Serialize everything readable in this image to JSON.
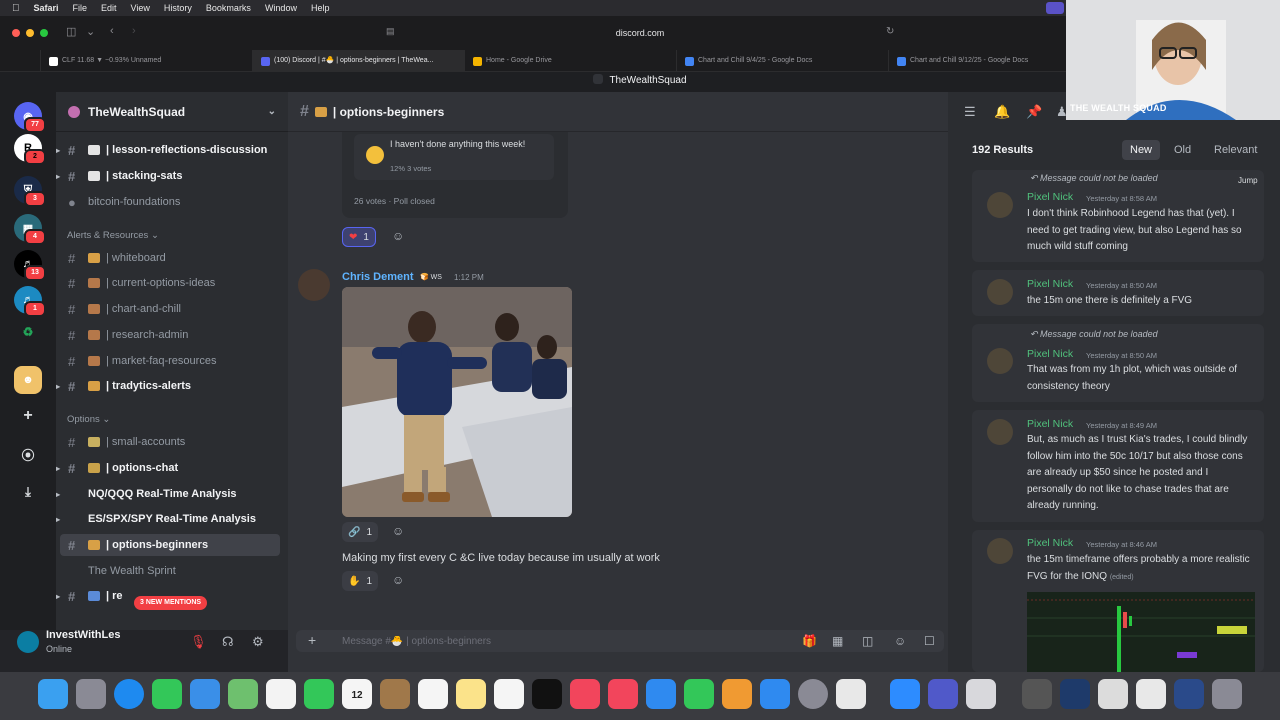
{
  "menubar": {
    "app": "Safari",
    "items": [
      "File",
      "Edit",
      "View",
      "History",
      "Bookmarks",
      "Window",
      "Help"
    ]
  },
  "browser": {
    "url": "discord.com",
    "tabs": [
      {
        "label": "CLF 11.68 ▼ −0.93% Unnamed",
        "active": false
      },
      {
        "label": "(100) Discord | #🐣 | options-beginners | TheWea...",
        "active": true
      },
      {
        "label": "Home - Google Drive",
        "active": false
      },
      {
        "label": "Chart and Chill 9/4/25 - Google Docs",
        "active": false
      },
      {
        "label": "Chart and Chill 9/12/25 - Google Docs",
        "active": false
      }
    ],
    "window_title": "TheWealthSquad"
  },
  "rail": {
    "servers": [
      {
        "icon": "discord-home-icon",
        "badge": "77"
      },
      {
        "icon": "server-r-icon",
        "letter": "R",
        "badge": "2"
      },
      {
        "icon": "server-shield-icon",
        "badge": "3"
      },
      {
        "icon": "server-book-icon",
        "badge": "4"
      },
      {
        "icon": "server-speaker-icon",
        "badge": "13"
      },
      {
        "icon": "server-speaker-icon",
        "badge": "1"
      },
      {
        "icon": "server-leaf-icon",
        "badge": ""
      },
      {
        "icon": "server-wealthsquad-icon",
        "badge": ""
      }
    ]
  },
  "server": {
    "name": "TheWealthSquad"
  },
  "sidebar": {
    "channels": [
      {
        "name": "| lesson-reflections-discussion",
        "unread": true,
        "arrow": true
      },
      {
        "name": "| stacking-sats",
        "unread": true,
        "arrow": true
      },
      {
        "name": "bitcoin-foundations",
        "unread": false,
        "arrow": false,
        "muted": true
      },
      {
        "name": "| whiteboard",
        "unread": false
      },
      {
        "name": "| current-options-ideas",
        "unread": false
      },
      {
        "name": "| chart-and-chill",
        "unread": false
      },
      {
        "name": "| research-admin",
        "unread": false
      },
      {
        "name": "| market-faq-resources",
        "unread": false
      },
      {
        "name": "| tradytics-alerts",
        "unread": true,
        "arrow": true
      },
      {
        "name": "| small-accounts",
        "unread": false
      },
      {
        "name": "| options-chat",
        "unread": true,
        "arrow": true
      },
      {
        "name": "NQ/QQQ Real-Time Analysis",
        "unread": true,
        "arrow": true
      },
      {
        "name": "ES/SPX/SPY Real-Time Analysis",
        "unread": true,
        "arrow": true
      },
      {
        "name": "| options-beginners",
        "selected": true
      },
      {
        "name": "The Wealth Sprint",
        "thread": true
      },
      {
        "name": "| re",
        "unread": true,
        "arrow": true
      }
    ],
    "categories": [
      "Alerts & Resources",
      "Options"
    ],
    "mentions": "3 NEW MENTIONS"
  },
  "user": {
    "name": "InvestWithLes",
    "status": "Online"
  },
  "chat": {
    "channel": "| options-beginners",
    "poll": {
      "option": "I haven't done anything this week!",
      "pct": "12%  3 votes",
      "footer": "26 votes  ·  Poll closed"
    },
    "reactions": [
      {
        "emoji": "heart-icon",
        "count": "1"
      },
      {
        "emoji": "link-icon",
        "count": "1"
      },
      {
        "emoji": "flex-icon",
        "count": "1"
      }
    ],
    "message": {
      "author": "Chris Dement",
      "tag": "WS",
      "time": "1:12 PM",
      "text": "Making my first every C &C live today because im usually at work"
    },
    "composer_placeholder": "Message #🐣 | options-beginners"
  },
  "results": {
    "count": "192 Results",
    "sort": [
      "New",
      "Old",
      "Relevant"
    ],
    "jump": "Jump",
    "items": [
      {
        "reply": "Message could not be loaded",
        "author": "Pixel Nick",
        "time": "Yesterday at 8:58 AM",
        "text": "I don't think Robinhood Legend has that (yet). I need to get trading view, but also Legend has so much wild stuff coming"
      },
      {
        "reply": "",
        "author": "Pixel Nick",
        "time": "Yesterday at 8:50 AM",
        "text": "the 15m one there is definitely a FVG"
      },
      {
        "reply": "Message could not be loaded",
        "author": "Pixel Nick",
        "time": "Yesterday at 8:50 AM",
        "text": "That was from my 1h plot, which was outside of consistency theory"
      },
      {
        "reply": "",
        "author": "Pixel Nick",
        "time": "Yesterday at 8:49 AM",
        "text": "But, as much as I trust Kia's trades, I could blindly follow him into the 50c 10/17 but also those cons are already up $50 since he posted and I personally do not like to chase trades that are already running."
      },
      {
        "reply": "",
        "author": "Pixel Nick",
        "time": "Yesterday at 8:46 AM",
        "text": "the 15m timeframe offers probably a more realistic FVG for the IONQ",
        "edited": "(edited)"
      }
    ]
  },
  "cam": {
    "label": "THE WEALTH SQUAD"
  },
  "dock": {
    "date_day": "12",
    "date_month": "SEP"
  }
}
